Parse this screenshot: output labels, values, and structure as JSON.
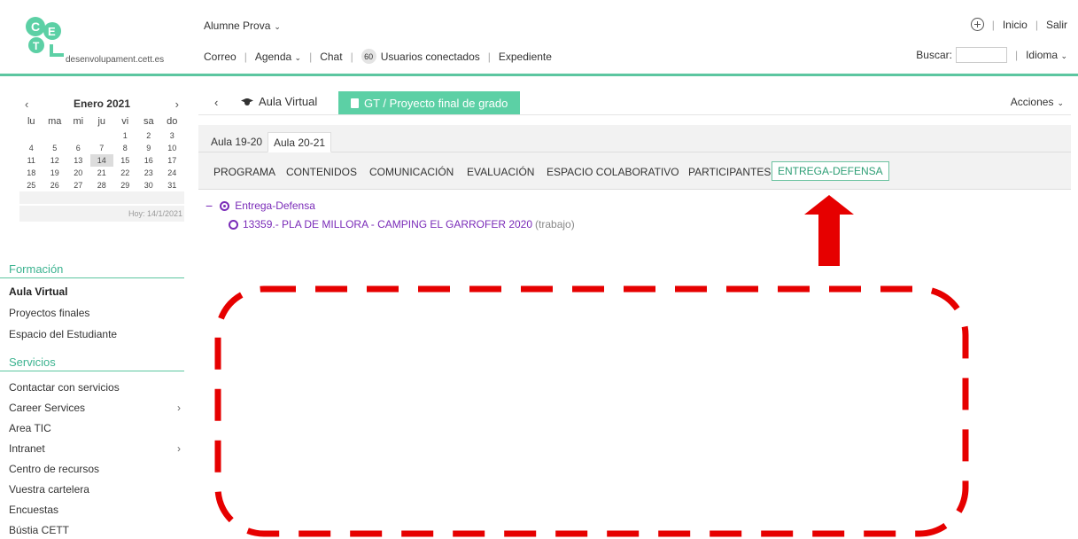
{
  "logo": {
    "letters": "CETT",
    "domain": "desenvolupament.cett.es"
  },
  "header": {
    "user_name": "Alumne Prova",
    "nav": {
      "correo": "Correo",
      "agenda": "Agenda",
      "chat": "Chat",
      "users_count": "60",
      "users_label": "Usuarios conectados",
      "expediente": "Expediente"
    },
    "inicio": "Inicio",
    "salir": "Salir",
    "search_label": "Buscar:",
    "search_value": "",
    "idioma": "Idioma"
  },
  "calendar": {
    "month": "Enero 2021",
    "prev": "‹",
    "next": "›",
    "weekdays": [
      "lu",
      "ma",
      "mi",
      "ju",
      "vi",
      "sa",
      "do"
    ],
    "weeks": [
      [
        "",
        "",
        "",
        "",
        "1",
        "2",
        "3"
      ],
      [
        "4",
        "5",
        "6",
        "7",
        "8",
        "9",
        "10"
      ],
      [
        "11",
        "12",
        "13",
        "14",
        "15",
        "16",
        "17"
      ],
      [
        "18",
        "19",
        "20",
        "21",
        "22",
        "23",
        "24"
      ],
      [
        "25",
        "26",
        "27",
        "28",
        "29",
        "30",
        "31"
      ]
    ],
    "today_day": "14",
    "today_text": "Hoy: 14/1/2021"
  },
  "sidebar": {
    "formacion_title": "Formación",
    "formacion_items": [
      "Aula Virtual",
      "Proyectos finales",
      "Espacio del Estudiante"
    ],
    "servicios_title": "Servicios",
    "servicios_items": [
      "Contactar con servicios",
      "Career Services",
      "Area TIC",
      "Intranet",
      "Centro de recursos",
      "Vuestra cartelera",
      "Encuestas",
      "Bústia CETT"
    ]
  },
  "main": {
    "back": "‹",
    "aula": "Aula Virtual",
    "course": "GT / Proyecto final de grado",
    "acciones": "Acciones",
    "year_tabs": [
      "Aula 19-20",
      "Aula 20-21"
    ],
    "section_tabs": [
      "PROGRAMA",
      "CONTENIDOS",
      "COMUNICACIÓN",
      "EVALUACIÓN",
      "ESPACIO COLABORATIVO",
      "PARTICIPANTES",
      "ENTREGA-DEFENSA"
    ],
    "tree_root": "Entrega-Defensa",
    "tree_item": "13359.- PLA DE MILLORA - CAMPING EL GARROFER 2020",
    "tree_item_type": "(trabajo)"
  },
  "colors": {
    "accent_green": "#5cd0a5",
    "annotation_red": "#e60000",
    "link_purple": "#7a2bb8"
  }
}
